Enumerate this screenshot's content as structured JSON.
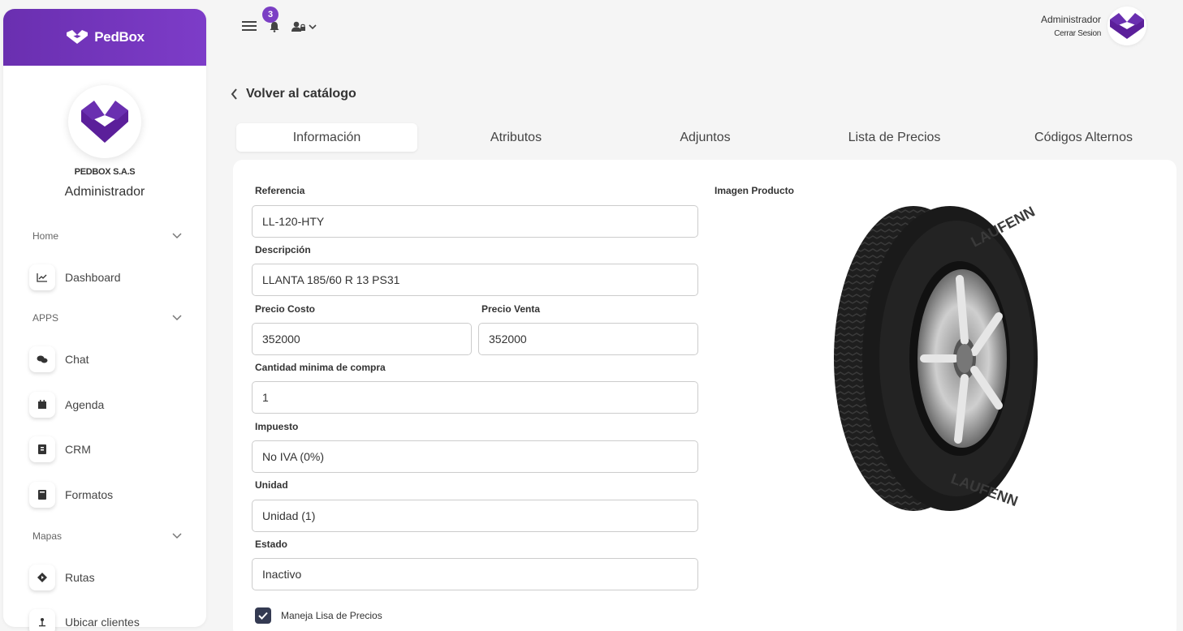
{
  "brand": {
    "name": "PedBox"
  },
  "sidebar": {
    "company": "PEDBOX S.A.S",
    "role": "Administrador",
    "sections": [
      {
        "label": "Home"
      },
      {
        "label": "APPS"
      },
      {
        "label": "Mapas"
      }
    ],
    "items": [
      {
        "label": "Dashboard",
        "icon": "chart-line-icon"
      },
      {
        "label": "Chat",
        "icon": "chat-bubbles-icon"
      },
      {
        "label": "Agenda",
        "icon": "calendar-icon"
      },
      {
        "label": "CRM",
        "icon": "address-book-icon"
      },
      {
        "label": "Formatos",
        "icon": "book-icon"
      },
      {
        "label": "Rutas",
        "icon": "route-diamond-icon"
      },
      {
        "label": "Ubicar clientes",
        "icon": "map-pin-icon"
      }
    ]
  },
  "topbar": {
    "notification_count": "3",
    "user_name": "Administrador",
    "logout_label": "Cerrar Sesion"
  },
  "page": {
    "back_label": "Volver al catálogo",
    "tabs": [
      {
        "label": "Información",
        "active": true
      },
      {
        "label": "Atributos"
      },
      {
        "label": "Adjuntos"
      },
      {
        "label": "Lista de Precios"
      },
      {
        "label": "Códigos Alternos"
      }
    ]
  },
  "form": {
    "reference_label": "Referencia",
    "reference_value": "LL-120-HTY",
    "description_label": "Descripción",
    "description_value": "LLANTA 185/60 R 13 PS31",
    "cost_label": "Precio Costo",
    "cost_value": "352000",
    "sale_label": "Precio Venta",
    "sale_value": "352000",
    "min_qty_label": "Cantidad minima de compra",
    "min_qty_value": "1",
    "tax_label": "Impuesto",
    "tax_value": "No IVA (0%)",
    "unit_label": "Unidad",
    "unit_value": "Unidad (1)",
    "status_label": "Estado",
    "status_value": "Inactivo",
    "price_list_checkbox_label": "Maneja Lisa de Precios",
    "price_list_checked": true,
    "image_label": "Imagen Producto"
  },
  "colors": {
    "brand_purple": "#7b3fc4",
    "checkbox_dark": "#343a52"
  }
}
